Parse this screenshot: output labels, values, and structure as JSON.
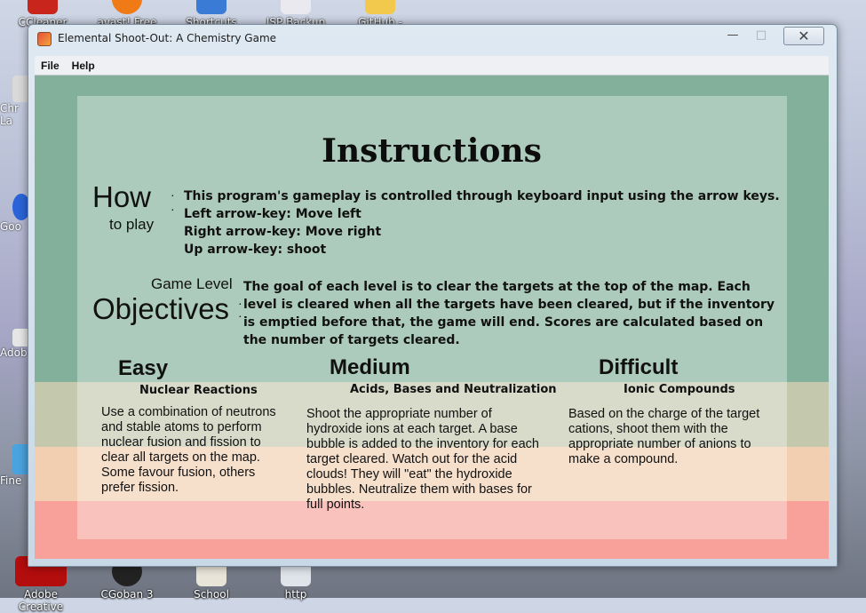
{
  "desktop": {
    "top_icons": [
      "CCleaner",
      "avast! Free",
      "Shortcuts",
      "ISP Backup",
      "GitHub -"
    ],
    "left_icons": [
      "Chr\nLa",
      "Goo",
      "Adob",
      "Fine"
    ],
    "bottom_icons": [
      "Adobe Creative",
      "CGoban 3",
      "School",
      "http"
    ]
  },
  "window": {
    "title": "Elemental Shoot-Out: A Chemistry Game",
    "controls": {
      "minimize": "—",
      "maximize": "□",
      "close": "✕"
    }
  },
  "menubar": {
    "items": [
      "File",
      "Help"
    ]
  },
  "game": {
    "colors": {
      "band1": "#82b09a",
      "band2": "#c4c8ac",
      "band3": "#f2cfb1",
      "band4": "#f8a19a"
    },
    "title": "Instructions",
    "how": {
      "big": "How",
      "small": "to play",
      "lines": [
        "This program's gameplay is controlled through keyboard input using the arrow keys.",
        "Left arrow-key: Move left",
        "Right arrow-key: Move right",
        "Up arrow-key: shoot"
      ]
    },
    "objectives": {
      "small": "Game Level",
      "big": "Objectives",
      "text": "The goal of each level is to clear the targets at the top of the map. Each level is cleared when all the targets have been cleared, but if the inventory is emptied before that, the game will end. Scores are calculated based on the number of targets cleared."
    },
    "difficulties": [
      {
        "name": "Easy",
        "subtitle": "Nuclear Reactions",
        "desc": "Use a combination of neutrons and stable atoms to perform nuclear fusion and fission to clear all targets on the map. Some favour fusion, others prefer fission."
      },
      {
        "name": "Medium",
        "subtitle": "Acids, Bases and Neutralization",
        "desc": "Shoot the appropriate number of hydroxide ions at each target. A base bubble is added to the inventory for each target cleared. Watch out for the acid clouds! They will \"eat\" the hydroxide bubbles. Neutralize them with bases for full points."
      },
      {
        "name": "Difficult",
        "subtitle": "Ionic Compounds",
        "desc": "Based on the charge of the target cations, shoot them with the appropriate number of anions to make a compound."
      }
    ]
  }
}
